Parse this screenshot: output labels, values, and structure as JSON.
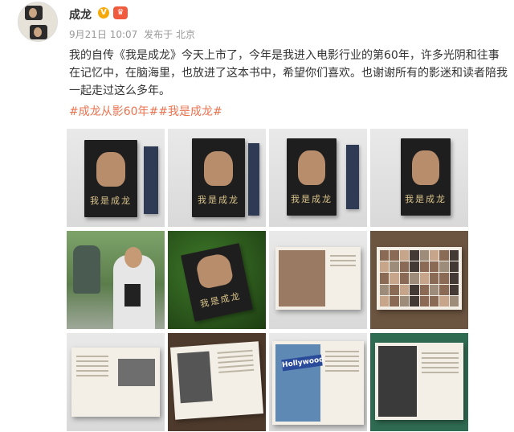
{
  "user": {
    "name": "成龙",
    "verified_badge": "V"
  },
  "meta": {
    "date": "9月21日 10:07",
    "source": "发布于 北京"
  },
  "post": {
    "text": "我的自传《我是成龙》今天上市了，今年是我进入电影行业的第60年，许多光阴和往事在记忆中，在脑海里，也放进了这本书中，希望你们喜欢。也谢谢所有的影迷和读者陪我一起走过这么多年。",
    "tags": "#成龙从影60年##我是成龙#"
  },
  "book_title": "我是成龙",
  "colors": {
    "tag": "#eb7350",
    "badge": "#f7a90a"
  },
  "photos": [
    {
      "name": "book-cover-front-photo"
    },
    {
      "name": "book-cover-front-2-photo"
    },
    {
      "name": "book-3d-left-photo"
    },
    {
      "name": "book-3d-right-photo"
    },
    {
      "name": "jackie-holding-book-photo"
    },
    {
      "name": "book-on-grass-photo"
    },
    {
      "name": "open-book-portrait-photo"
    },
    {
      "name": "open-book-mosaic-photo"
    },
    {
      "name": "open-book-group-photo"
    },
    {
      "name": "open-book-tower-photo"
    },
    {
      "name": "open-book-hollywood-photo"
    },
    {
      "name": "open-book-green-photo"
    }
  ]
}
